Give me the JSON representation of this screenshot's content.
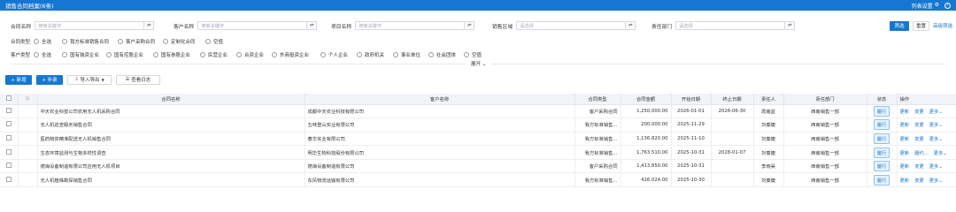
{
  "header": {
    "title": "销售合同档案(6条)",
    "settings_label": "列表设置",
    "help_icon": "help-icon"
  },
  "filters": [
    {
      "label": "合同名称",
      "placeholder": "搜索关键字"
    },
    {
      "label": "客户名称",
      "placeholder": "搜索关键字"
    },
    {
      "label": "项目名称",
      "placeholder": "搜索关键字"
    },
    {
      "label": "销售区域",
      "placeholder": "请选择"
    },
    {
      "label": "责任部门",
      "placeholder": "请选择"
    }
  ],
  "filter_actions": {
    "search": "筛选",
    "reset": "重置",
    "advanced": "高级筛选"
  },
  "contract_types": {
    "label": "合同类型",
    "options": [
      "全选",
      "我方标准销售合同",
      "客户采购合同",
      "定制化合同",
      "空值"
    ]
  },
  "customer_types": {
    "label": "客户类型",
    "options": [
      "全选",
      "国有独资企业",
      "国有控股企业",
      "国有参股企业",
      "民营企业",
      "合资企业",
      "外商投资企业",
      "个人企业",
      "政府机关",
      "事业单位",
      "社会团体",
      "空值"
    ]
  },
  "expand_label": "展开",
  "toolbar": {
    "new": "+ 新增",
    "supplement": "+ 补录",
    "import_export": "导入导出",
    "operation_log": "查看日志"
  },
  "table": {
    "columns": [
      "合同名称",
      "客户名称",
      "合同类型",
      "合同金额",
      "开始日期",
      "终止日期",
      "责任人",
      "责任部门",
      "状态",
      "操作"
    ],
    "rows": [
      {
        "name": "中天农业科技公司农用无人机采购合同",
        "customer": "成都中天农业科技有限公司",
        "type": "客户采购合同",
        "amount": "1,250,000.00",
        "start": "2026-01-01",
        "end": "2026-06-30",
        "owner": "周南益",
        "dept": "西南销售一部",
        "status": "履行"
      },
      {
        "name": "无人机巡查服务销售合同",
        "customer": "五味登山实业有限公司",
        "type": "我方标准销售...",
        "amount": "200,000.00",
        "start": "2025-11-29",
        "end": "",
        "owner": "刘秦婕",
        "dept": "西南销售一部",
        "status": "履行"
      },
      {
        "name": "医药物资精准配送无人机销售合同",
        "customer": "春华实业有限公司",
        "type": "我方标准销售...",
        "amount": "1,136,820.00",
        "start": "2025-11-10",
        "end": "",
        "owner": "刘秦婕",
        "dept": "西南销售一部",
        "status": "履行"
      },
      {
        "name": "生态环境监测与生物多样性调查",
        "customer": "明华生物科技股份有限公司",
        "type": "我方标准销售...",
        "amount": "1,763,510.00",
        "start": "2025-10-31",
        "end": "2028-01-07",
        "owner": "刘秦婕",
        "dept": "西南销售一部",
        "status": "履行"
      },
      {
        "name": "德海设备制造有限公司应用无人机项目",
        "customer": "德海设备制造有限公司",
        "type": "客户采购合同",
        "amount": "1,413,850.00",
        "start": "2025-10-31",
        "end": "",
        "owner": "李雨昊",
        "dept": "西南销售一部",
        "status": "履行"
      },
      {
        "name": "无人机植株勘探销售合同",
        "customer": "东风物流运输有限公司",
        "type": "我方标准销售...",
        "amount": "426,024.00",
        "start": "2025-10-30",
        "end": "",
        "owner": "刘秦婕",
        "dept": "西南销售一部",
        "status": "履行"
      }
    ],
    "row_actions": [
      "更新",
      "变更",
      "更多"
    ],
    "row_actions_alt": [
      "更新",
      "履约...",
      "更多"
    ]
  }
}
